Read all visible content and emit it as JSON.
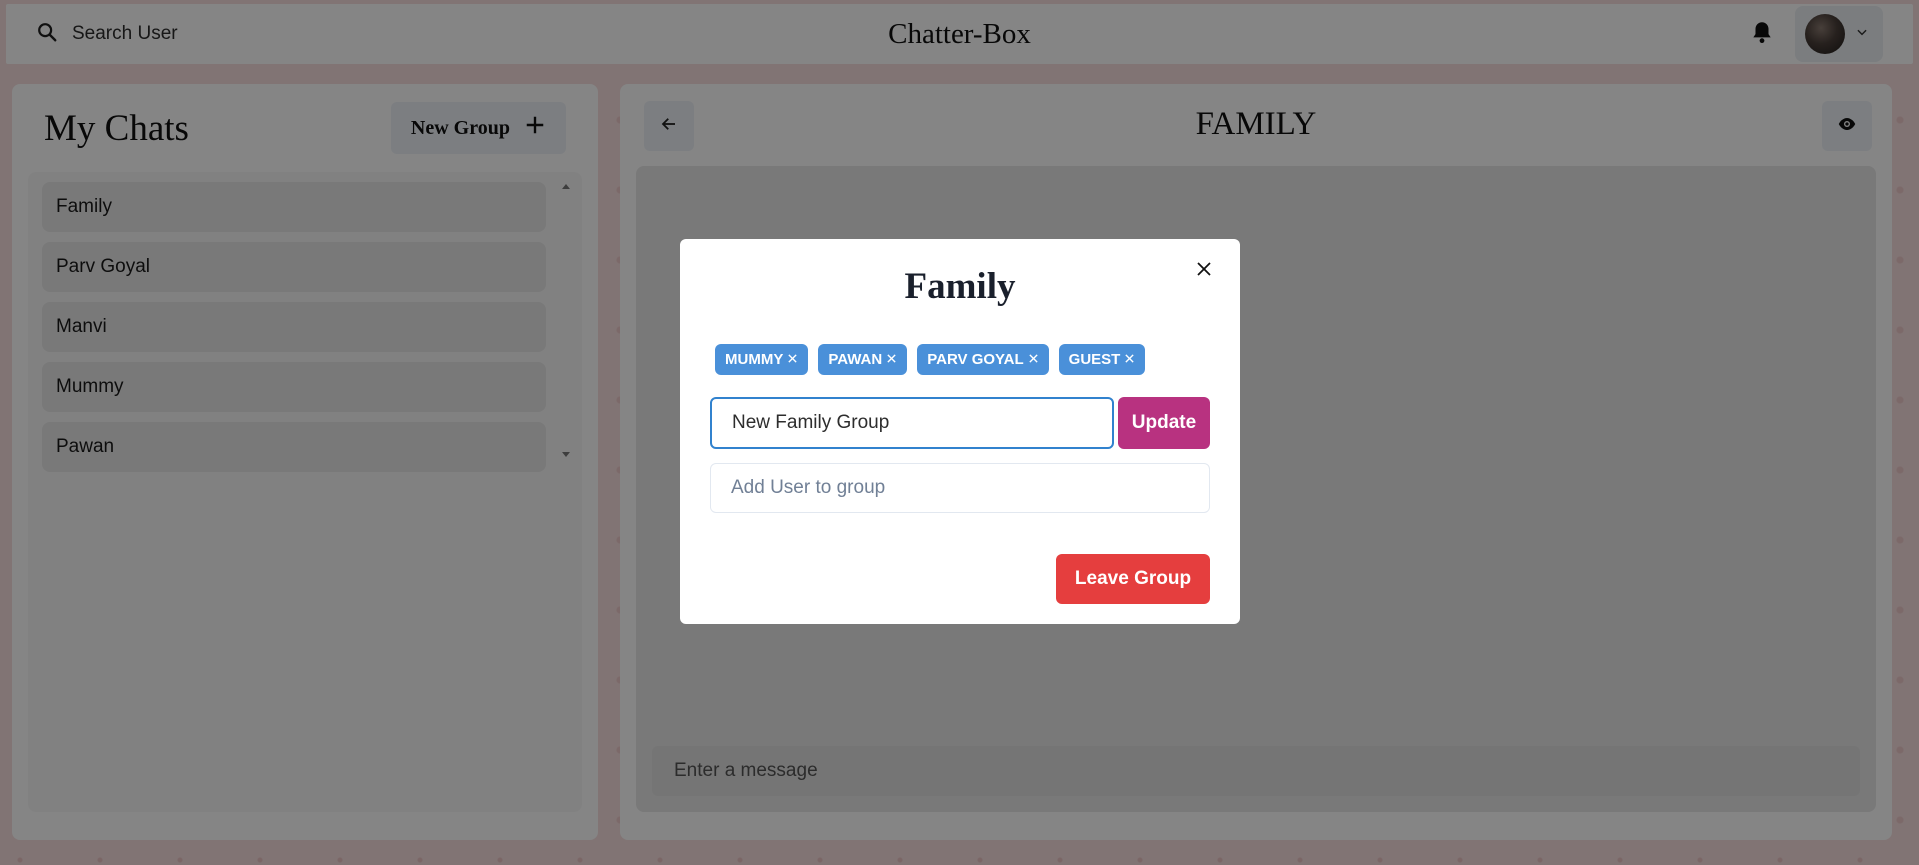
{
  "header": {
    "search_label": "Search User",
    "app_title": "Chatter-Box"
  },
  "chats": {
    "title": "My Chats",
    "new_group_label": "New Group",
    "items": [
      {
        "label": "Family"
      },
      {
        "label": "Parv Goyal"
      },
      {
        "label": "Manvi"
      },
      {
        "label": "Mummy"
      },
      {
        "label": "Pawan"
      }
    ]
  },
  "chat": {
    "title": "FAMILY",
    "message_placeholder": "Enter a message"
  },
  "modal": {
    "title": "Family",
    "members": [
      {
        "label": "MUMMY"
      },
      {
        "label": "PAWAN"
      },
      {
        "label": "PARV GOYAL"
      },
      {
        "label": "GUEST"
      }
    ],
    "rename_value": "New Family Group",
    "update_label": "Update",
    "add_user_placeholder": "Add User to group",
    "leave_label": "Leave Group"
  },
  "colors": {
    "tag": "#4a90d9",
    "update": "#b83280",
    "leave": "#e53e3e",
    "focus": "#3182ce"
  },
  "icons": {
    "search": "search-icon",
    "bell": "bell-icon",
    "avatar_chevron": "chevron-down-icon",
    "new_group": "plus-icon",
    "back": "arrow-left-icon",
    "view": "eye-icon",
    "close": "close-icon",
    "tag_remove": "close-icon"
  }
}
